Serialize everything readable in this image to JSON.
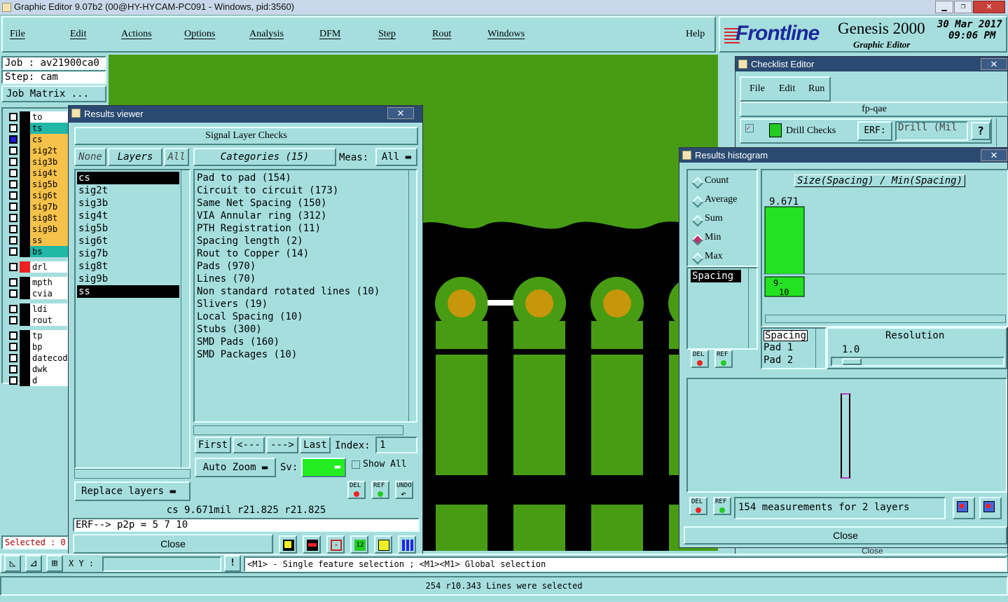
{
  "window": {
    "title": "Graphic Editor 9.07b2 (00@HY-HYCAM-PC091 - Windows, pid:3560)"
  },
  "menu": {
    "items": [
      "File",
      "Edit",
      "Actions",
      "Options",
      "Analysis",
      "DFM",
      "Step",
      "Rout",
      "Windows"
    ],
    "help": "Help"
  },
  "brand": {
    "logo": "Frontline",
    "product": "Genesis 2000",
    "subtitle": "Graphic Editor",
    "date": "30 Mar 2017",
    "time": "09:06 PM"
  },
  "job": {
    "job": "Job : av21900ca0",
    "step": "Step: cam",
    "matrix": "Job Matrix ..."
  },
  "layers": [
    {
      "name": "to",
      "color": "#ffffff"
    },
    {
      "name": "ts",
      "color": "#22b8a8"
    },
    {
      "name": "cs",
      "color": "#f6c24a",
      "checked": true
    },
    {
      "name": "sig2t",
      "color": "#f6c24a"
    },
    {
      "name": "sig3b",
      "color": "#f6c24a"
    },
    {
      "name": "sig4t",
      "color": "#f6c24a"
    },
    {
      "name": "sig5b",
      "color": "#f6c24a"
    },
    {
      "name": "sig6t",
      "color": "#f6c24a"
    },
    {
      "name": "sig7b",
      "color": "#f6c24a"
    },
    {
      "name": "sig8t",
      "color": "#f6c24a"
    },
    {
      "name": "sig9b",
      "color": "#f6c24a"
    },
    {
      "name": "ss",
      "color": "#f6c24a"
    },
    {
      "name": "bs",
      "color": "#22b8a8"
    },
    {
      "name": "drl",
      "color": "#ffffff"
    },
    {
      "name": "mpth",
      "color": "#ffffff"
    },
    {
      "name": "cvia",
      "color": "#ffffff"
    },
    {
      "name": "ldi",
      "color": "#ffffff"
    },
    {
      "name": "rout",
      "color": "#ffffff"
    },
    {
      "name": "tp",
      "color": "#ffffff"
    },
    {
      "name": "bp",
      "color": "#ffffff"
    },
    {
      "name": "datecode",
      "color": "#ffffff"
    },
    {
      "name": "dwk",
      "color": "#ffffff"
    },
    {
      "name": "d",
      "color": "#ffffff"
    }
  ],
  "selected": "Selected : 0",
  "results_viewer": {
    "title": "Results viewer",
    "header": "Signal Layer Checks",
    "none": "None",
    "layers_label": "Layers",
    "all": "All",
    "categories_label": "Categories (15)",
    "meas_label": "Meas:",
    "meas_value": "All",
    "layer_list": [
      "cs",
      "sig2t",
      "sig3b",
      "sig4t",
      "sig5b",
      "sig6t",
      "sig7b",
      "sig8t",
      "sig9b",
      "ss"
    ],
    "categories": [
      "Pad to pad (154)",
      "Circuit to circuit (173)",
      "Same Net Spacing (150)",
      "VIA Annular ring (312)",
      "PTH Registration (11)",
      "Spacing length (2)",
      "Rout to Copper (14)",
      "Pads (970)",
      "Lines (70)",
      "Non standard rotated lines (10)",
      "Slivers (19)",
      "Local Spacing (10)",
      "Stubs (300)",
      "SMD Pads (160)",
      "SMD Packages (10)"
    ],
    "first": "First",
    "prev": "<---",
    "next": "--->",
    "last": "Last",
    "index_label": "Index:",
    "index_value": "1",
    "auto_zoom": "Auto Zoom",
    "sv": "Sv:",
    "show_all": "Show All",
    "replace": "Replace layers",
    "del": "DEL",
    "ref": "REF",
    "undo": "UNDO",
    "status": "cs 9.671mil  r21.825  r21.825",
    "erf": "ERF--> p2p = 5 7 10",
    "close": "Close"
  },
  "checklist": {
    "title": "Checklist Editor",
    "menu": [
      "File",
      "Edit",
      "Run"
    ],
    "name": "fp-qae",
    "row": "Drill Checks",
    "erf": "ERF:",
    "field": "Drill (Mil",
    "help": "?",
    "close": "Close"
  },
  "histogram": {
    "title": "Results histogram",
    "modes": [
      "Count",
      "Average",
      "Sum",
      "Min",
      "Max"
    ],
    "selected_mode": "Min",
    "chart_title": "Size(Spacing) / Min(Spacing)",
    "list": [
      "Spacing"
    ],
    "chart_data": {
      "type": "bar",
      "categories": [
        "9-10"
      ],
      "values": [
        9.671
      ],
      "labels": [
        "9.671"
      ]
    },
    "res_list": [
      "Spacing",
      "Pad 1",
      "Pad 2"
    ],
    "resolution_label": "Resolution",
    "resolution_value": "1.0",
    "measurements": "154 measurements for 2 layers",
    "close": "Close",
    "del": "DEL",
    "ref": "REF"
  },
  "bottom": {
    "xy_label": "X Y :",
    "hint": "<M1> - Single feature selection ; <M1><M1> Global selection",
    "status": "254 r10.343 Lines were selected"
  }
}
